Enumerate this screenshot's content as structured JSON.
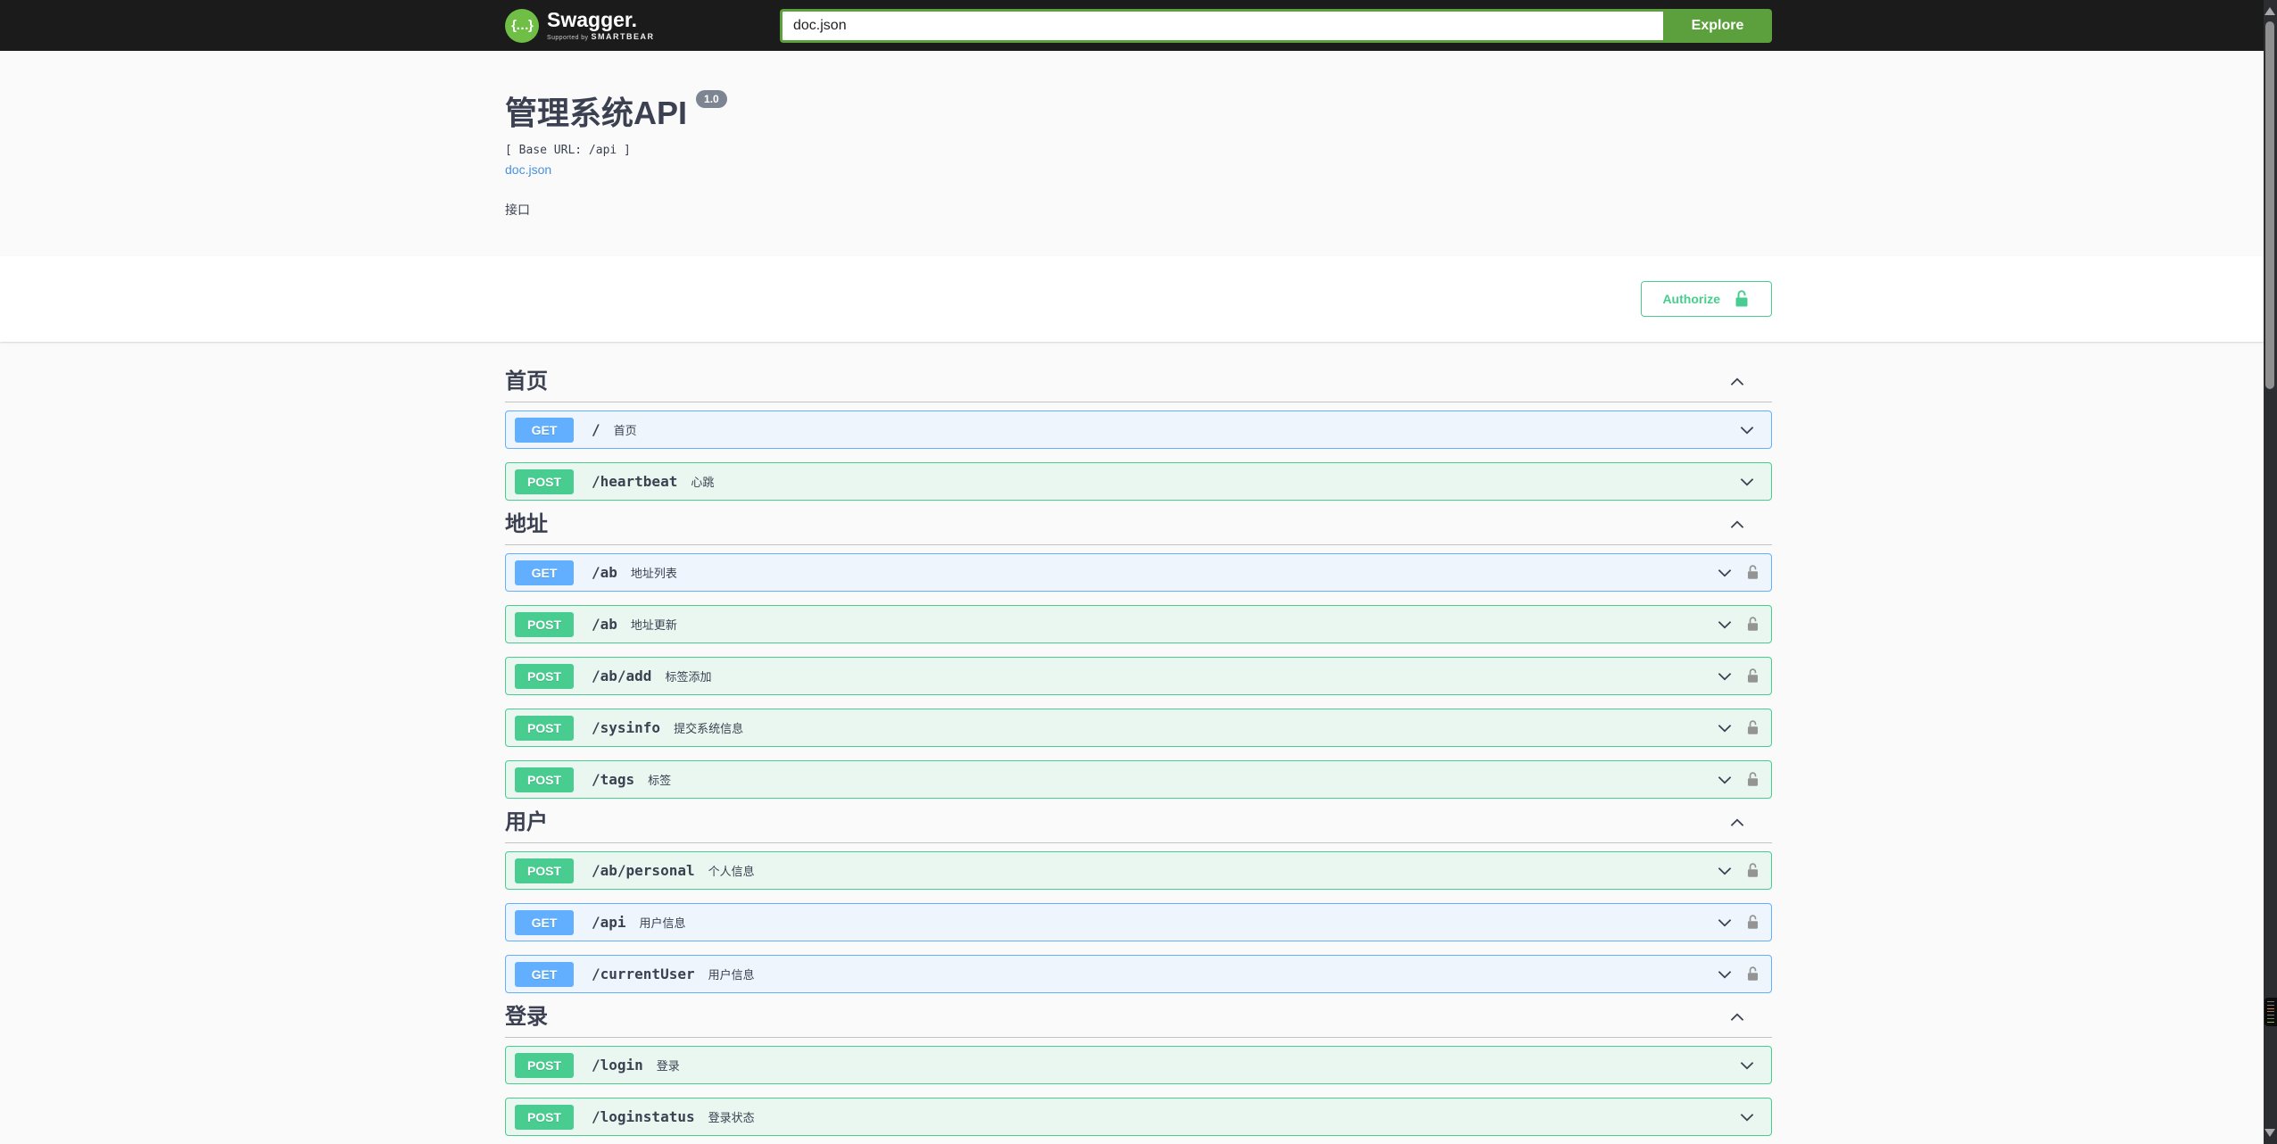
{
  "topbar": {
    "logo_text": "Swagger.",
    "logo_sub": "Supported by",
    "logo_sub_brand": "SMARTBEAR",
    "logo_glyph": "{…}",
    "search_value": "doc.json",
    "explore_label": "Explore"
  },
  "info": {
    "title": "管理系统API",
    "version_badge": "1.0",
    "base_url_line": "[ Base URL: /api ]",
    "spec_link": "doc.json",
    "description": "接口"
  },
  "auth": {
    "authorize_label": "Authorize"
  },
  "colors": {
    "topbar_bg": "#1b1b1b",
    "explore_green": "#5ca03e",
    "logo_green": "#6fbe46",
    "get_blue": "#61affe",
    "post_green": "#49cc90",
    "authorize_green": "#49cc90",
    "link_blue": "#4990e2",
    "version_badge_gray": "#7d8492",
    "text_dark": "#3b4151",
    "lock_gray": "#949494"
  },
  "sections": [
    {
      "title": "首页",
      "rows": [
        {
          "method": "GET",
          "path": "/",
          "summary": "首页"
        },
        {
          "method": "POST",
          "path": "/heartbeat",
          "summary": "心跳"
        }
      ]
    },
    {
      "title": "地址",
      "rows": [
        {
          "method": "GET",
          "path": "/ab",
          "summary": "地址列表"
        },
        {
          "method": "POST",
          "path": "/ab",
          "summary": "地址更新"
        },
        {
          "method": "POST",
          "path": "/ab/add",
          "summary": "标签添加"
        },
        {
          "method": "POST",
          "path": "/sysinfo",
          "summary": "提交系统信息"
        },
        {
          "method": "POST",
          "path": "/tags",
          "summary": "标签"
        }
      ]
    },
    {
      "title": "用户",
      "rows": [
        {
          "method": "POST",
          "path": "/ab/personal",
          "summary": "个人信息"
        },
        {
          "method": "GET",
          "path": "/api",
          "summary": "用户信息"
        },
        {
          "method": "GET",
          "path": "/currentUser",
          "summary": "用户信息"
        }
      ]
    },
    {
      "title": "登录",
      "rows": [
        {
          "method": "POST",
          "path": "/login",
          "summary": "登录"
        },
        {
          "method": "POST",
          "path": "/loginstatus",
          "summary": "登录状态"
        }
      ]
    }
  ]
}
